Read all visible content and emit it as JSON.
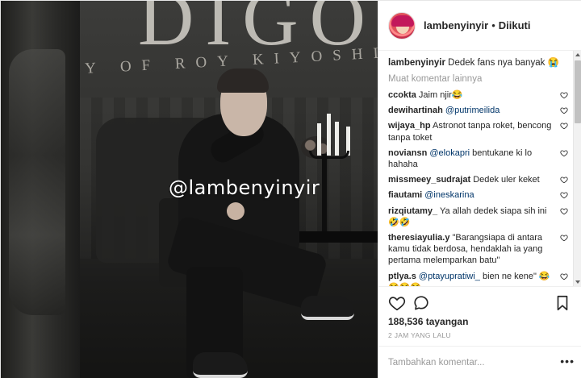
{
  "media": {
    "banner_big": "DIGO",
    "banner_small": "Y OF ROY KIYOSHI",
    "watermark": "@lambenyinyir"
  },
  "header": {
    "username": "lambenyinyir",
    "separator": "•",
    "follow_status": "Diikuti",
    "avatar_icon": "avatar-image"
  },
  "caption": {
    "user": "lambenyinyir",
    "text": "Dedek fans nya banyak 😭"
  },
  "more_comments_label": "Muat komentar lainnya",
  "comments": [
    {
      "user": "ccokta",
      "mention": "",
      "text": "Jaim njir😂"
    },
    {
      "user": "dewihartinah",
      "mention": "@putrimeilida",
      "text": ""
    },
    {
      "user": "wijaya_hp",
      "mention": "",
      "text": "Astronot tanpa roket, bencong tanpa toket"
    },
    {
      "user": "noviansn",
      "mention": "@elokapri",
      "text": "bentukane ki lo hahaha"
    },
    {
      "user": "missmeey_sudrajat",
      "mention": "",
      "text": "Dedek uler keket"
    },
    {
      "user": "fiautami",
      "mention": "@ineskarina",
      "text": ""
    },
    {
      "user": "rizqiutamy_",
      "mention": "",
      "text": "Ya allah dedek siapa sih ini 🤣🤣"
    },
    {
      "user": "theresiayulia.y",
      "mention": "",
      "text": "\"Barangsiapa di antara kamu tidak berdosa, hendaklah ia yang pertama melemparkan batu\""
    },
    {
      "user": "ptlya.s",
      "mention": "@ptayupratiwi_",
      "text": "bien ne kene\" 😂😂😂😂"
    }
  ],
  "stats": {
    "views": "188,536 tayangan",
    "time": "2 JAM YANG LALU"
  },
  "add_comment": {
    "placeholder": "Tambahkan komentar...",
    "more_label": "•••"
  },
  "icons": {
    "like": "heart-icon",
    "comment": "comment-icon",
    "save": "bookmark-icon"
  }
}
